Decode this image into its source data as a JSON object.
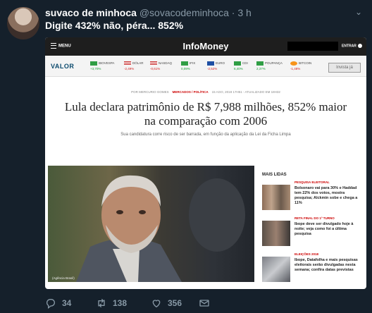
{
  "tweet": {
    "display_name": "suvaco de minhoca",
    "handle": "@sovacodeminhoca",
    "separator": " · ",
    "time": "3 h",
    "text": "Digite 432% não, péra... 852%",
    "replies": "34",
    "retweets": "138",
    "likes": "356"
  },
  "article": {
    "menu_label": "MENU",
    "site_logo": "InfoMoney",
    "enter_label": "ENTRAR",
    "ticker_brand": "VALOR",
    "tickers": [
      {
        "name": "IBOVESPA",
        "change": "+3,70%",
        "flag": "br",
        "dir": "up"
      },
      {
        "name": "DÓLAR",
        "change": "-2,49%",
        "flag": "us",
        "dir": "down"
      },
      {
        "name": "NASDAQ",
        "change": "-0,61%",
        "flag": "us",
        "dir": "down"
      },
      {
        "name": "IFIX",
        "change": "0,09%",
        "flag": "br",
        "dir": "up"
      },
      {
        "name": "EURO",
        "change": "-2,52%",
        "flag": "eu",
        "dir": "down"
      },
      {
        "name": "CDI",
        "change": "6,40%",
        "flag": "br",
        "dir": "up"
      },
      {
        "name": "POUPANÇA",
        "change": "2,37%",
        "flag": "br",
        "dir": "up"
      },
      {
        "name": "BITCOIN",
        "change": "-1,48%",
        "flag": "btc",
        "dir": "down"
      }
    ],
    "invest_button": "Invista já",
    "byline_author": "POR MERCURIO GOMES",
    "byline_section": "MERCADOS / POLÍTICA",
    "byline_date": "15 AGO, 2018 17H51 - ATUALIZADO EM 18H32",
    "headline": "Lula declara patrimônio de R$ 7,988 milhões, 852% maior na comparação com 2006",
    "subheadline": "Sua candidatura corre risco de ser barrada, em função da aplicação da Lei da Ficha Limpa",
    "photo_caption": "(Agência Brasil)",
    "most_read_title": "MAIS LIDAS",
    "most_read": [
      {
        "tag": "PESQUISA ELEITORAL",
        "text": "Bolsonaro vai para 30% e Haddad tem 22% dos votos, mostra pesquisa; Alckmin sobe e chega a 11%"
      },
      {
        "tag": "RETA FINAL DO 1º TURNO",
        "text": "Ibope deve ser divulgado hoje à noite; veja como foi a última pesquisa"
      },
      {
        "tag": "ELEIÇÕES 2018",
        "text": "Ibope, Datafolha e mais pesquisas eleitorais serão divulgadas nesta semana; confira datas previstas"
      }
    ]
  },
  "colors": {
    "background": "#15202b",
    "muted": "#8899a6",
    "headline_red": "#c00"
  }
}
